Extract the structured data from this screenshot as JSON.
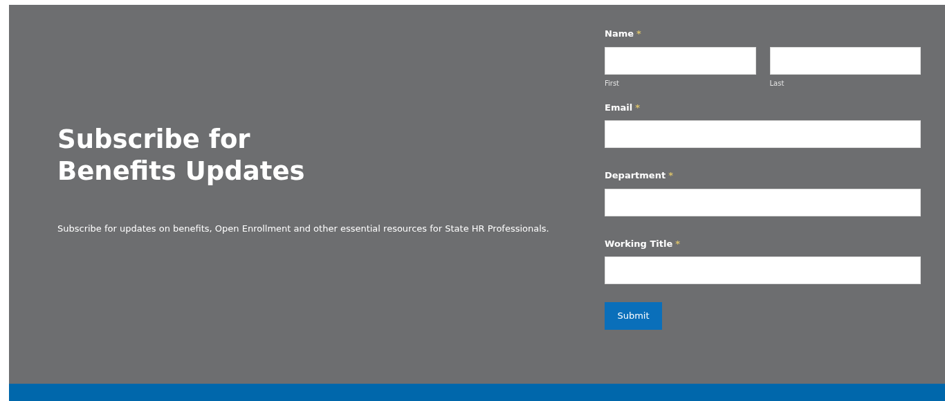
{
  "intro": {
    "title_lines": [
      "Subscribe for",
      "Benefits Updates"
    ],
    "text": "Subscribe for updates on benefits, Open Enrollment and other essential resources for State HR Professionals."
  },
  "form": {
    "fields": [
      {
        "kind": "name",
        "label": "Name",
        "mark": "*",
        "sublabels": [
          "First",
          "Last"
        ]
      },
      {
        "kind": "text",
        "label": "Email",
        "mark": "*"
      },
      {
        "kind": "text",
        "label": "Department",
        "mark": "*"
      },
      {
        "kind": "text",
        "label": "Working Title",
        "mark": "*"
      }
    ],
    "submit": "Submit"
  }
}
